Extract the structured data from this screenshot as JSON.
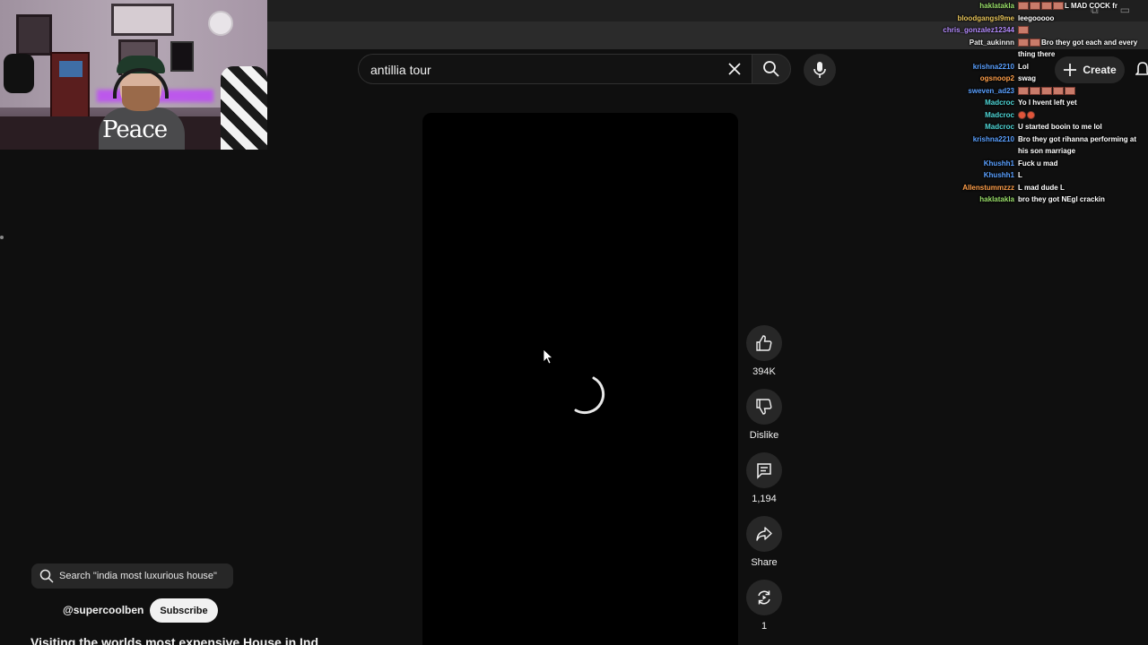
{
  "search": {
    "query": "antillia tour"
  },
  "header": {
    "create_label": "Create"
  },
  "actions": {
    "like_count": "394K",
    "dislike_label": "Dislike",
    "comments_count": "1,194",
    "share_label": "Share",
    "remix_count": "1"
  },
  "overlay": {
    "suggested_search": "Search \"india most luxurious house\"",
    "channel": "@supercoolben",
    "subscribe_label": "Subscribe",
    "title": "Visiting the worlds most expensive House in Ind"
  },
  "webcam": {
    "shirt_text": "Peace"
  },
  "chat": [
    {
      "user": "haklatakla",
      "color": "#9adf6a",
      "message": "L MAD COCK fr",
      "emotes": 4
    },
    {
      "user": "bloodgangsl9me",
      "color": "#e6c35a",
      "message": "leegooooo",
      "emotes": 0
    },
    {
      "user": "chris_gonzalez12344",
      "color": "#b58cff",
      "message": "",
      "emotes": 1
    },
    {
      "user": "Patt_aukinnn",
      "color": "#f0f0f0",
      "message": "Bro they got each and every thing there",
      "emotes": 2
    },
    {
      "user": "krishna2210",
      "color": "#5aa0ff",
      "message": "Lol",
      "emotes": 0
    },
    {
      "user": "ogsnoop2",
      "color": "#ff9f4a",
      "message": "swag",
      "emotes": 0
    },
    {
      "user": "sweven_ad23",
      "color": "#5aa0ff",
      "message": "",
      "emotes": 5
    },
    {
      "user": "Madcroc",
      "color": "#4fd6d6",
      "message": "Yo I hvent left yet",
      "emotes": 0
    },
    {
      "user": "Madcroc",
      "color": "#4fd6d6",
      "message": "",
      "emotes": 2,
      "round": true
    },
    {
      "user": "Madcroc",
      "color": "#4fd6d6",
      "message": "U started booin to me lol",
      "emotes": 0
    },
    {
      "user": "krishna2210",
      "color": "#5aa0ff",
      "message": "Bro they got rihanna performing at his son marriage",
      "emotes": 0
    },
    {
      "user": "Khushh1",
      "color": "#5aa0ff",
      "message": "Fuck u mad",
      "emotes": 0
    },
    {
      "user": "Khushh1",
      "color": "#5aa0ff",
      "message": "L",
      "emotes": 0
    },
    {
      "user": "Allenstummzzz",
      "color": "#ff9f4a",
      "message": "L mad dude L",
      "emotes": 0
    },
    {
      "user": "haklatakla",
      "color": "#9adf6a",
      "message": "bro they got NEgl crackin",
      "emotes": 0
    }
  ]
}
